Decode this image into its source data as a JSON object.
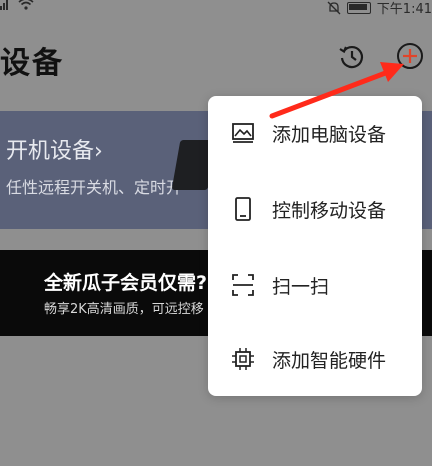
{
  "status_bar": {
    "time": "下午1:41",
    "left_icons": [
      "signal-icon",
      "wifi-icon"
    ],
    "right_icons": [
      "mute-icon",
      "battery-icon"
    ]
  },
  "header": {
    "title": "设备",
    "icons": [
      "history-icon",
      "add-icon"
    ],
    "add_icon_color": "#e0442a"
  },
  "banner_remote": {
    "title": "开机设备",
    "chevron": "›",
    "subtitle": "任性远程开关机、定时开",
    "background": "#5a6179"
  },
  "banner_vip": {
    "title": "全新瓜子会员仅需?",
    "subtitle": "畅享2K高清画质，可远控移",
    "background": "#0a0a0a"
  },
  "popup_menu": {
    "items": [
      {
        "label": "添加电脑设备",
        "icon": "computer-image-icon"
      },
      {
        "label": "控制移动设备",
        "icon": "phone-icon"
      },
      {
        "label": "扫一扫",
        "icon": "scan-icon"
      },
      {
        "label": "添加智能硬件",
        "icon": "chip-icon"
      }
    ]
  },
  "annotation": {
    "arrow_color": "#ff2a1a",
    "target": "add-icon"
  }
}
